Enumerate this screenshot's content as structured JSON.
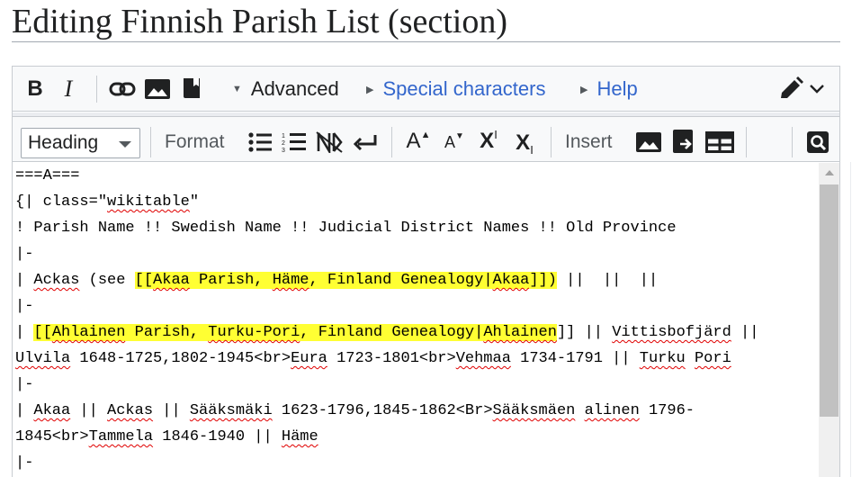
{
  "page": {
    "title": "Editing Finnish Parish List (section)"
  },
  "toolbar_top": {
    "bold_label": "B",
    "italic_label": "I",
    "advanced_label": "Advanced",
    "special_characters_label": "Special characters",
    "help_label": "Help",
    "link_color": "#3366cc",
    "icons": [
      "link-icon",
      "image-icon",
      "book-icon",
      "pencil-icon",
      "chevron-down-icon"
    ]
  },
  "toolbar_advanced": {
    "heading_select_value": "Heading",
    "format_label": "Format",
    "insert_label": "Insert",
    "big_label": "A",
    "small_label": "A",
    "superscript_label": "X",
    "superscript_mark": "I",
    "subscript_label": "X",
    "subscript_mark": "I",
    "icons": [
      "bulleted-list-icon",
      "numbered-list-icon",
      "nowiki-icon",
      "newline-icon",
      "big-text-icon",
      "small-text-icon",
      "superscript-icon",
      "subscript-icon",
      "insert-image-icon",
      "insert-gallery-icon",
      "insert-table-icon",
      "search-replace-icon"
    ]
  },
  "editor": {
    "highlight_color": "#ffff33",
    "lines": [
      [
        {
          "t": "===A==="
        }
      ],
      [
        {
          "t": "{| class=\""
        },
        {
          "t": "wikitable",
          "sq": true
        },
        {
          "t": "\""
        }
      ],
      [
        {
          "t": "! Parish Name !! Swedish Name !! Judicial District Names !! Old Province"
        }
      ],
      [
        {
          "t": "|-"
        }
      ],
      [
        {
          "t": "| "
        },
        {
          "t": "Ackas",
          "sq": true
        },
        {
          "t": " (see "
        },
        {
          "t": "[[",
          "hl": true
        },
        {
          "t": "Akaa",
          "hl": true,
          "sq": true
        },
        {
          "t": " Parish, ",
          "hl": true
        },
        {
          "t": "Häme",
          "hl": true,
          "sq": true
        },
        {
          "t": ", Finland Genealogy|",
          "hl": true
        },
        {
          "t": "Akaa",
          "hl": true,
          "sq": true
        },
        {
          "t": "]])",
          "hl": true
        },
        {
          "t": " ||  ||  ||"
        }
      ],
      [
        {
          "t": "|-"
        }
      ],
      [
        {
          "t": "| "
        },
        {
          "t": "[[",
          "hl": true
        },
        {
          "t": "Ahlainen",
          "hl": true,
          "sq": true
        },
        {
          "t": " Parish, ",
          "hl": true
        },
        {
          "t": "Turku-Pori",
          "hl": true,
          "sq": true
        },
        {
          "t": ", Finland Genealogy|",
          "hl": true
        },
        {
          "t": "Ahlainen",
          "hl": true,
          "sq": true
        },
        {
          "t": "]]"
        },
        {
          "t": " || "
        },
        {
          "t": "Vittisbofjärd",
          "sq": true
        },
        {
          "t": " ||"
        }
      ],
      [
        {
          "t": "Ulvila",
          "sq": true
        },
        {
          "t": " 1648-1725,1802-1945<br>"
        },
        {
          "t": "Eura",
          "sq": true
        },
        {
          "t": " 1723-1801<br>"
        },
        {
          "t": "Vehmaa",
          "sq": true
        },
        {
          "t": " 1734-1791 || "
        },
        {
          "t": "Turku",
          "sq": true
        },
        {
          "t": " "
        },
        {
          "t": "Pori",
          "sq": true
        }
      ],
      [
        {
          "t": "|-"
        }
      ],
      [
        {
          "t": "| "
        },
        {
          "t": "Akaa",
          "sq": true
        },
        {
          "t": " || "
        },
        {
          "t": "Ackas",
          "sq": true
        },
        {
          "t": " || "
        },
        {
          "t": "Sääksmäki",
          "sq": true
        },
        {
          "t": " 1623-1796,1845-1862<Br>"
        },
        {
          "t": "Sääksmäen",
          "sq": true
        },
        {
          "t": " "
        },
        {
          "t": "alinen",
          "sq": true
        },
        {
          "t": " 1796-"
        }
      ],
      [
        {
          "t": "1845<br>"
        },
        {
          "t": "Tammela",
          "sq": true
        },
        {
          "t": " 1846-1940 || "
        },
        {
          "t": "Häme",
          "sq": true
        }
      ],
      [
        {
          "t": "|-"
        }
      ]
    ]
  }
}
